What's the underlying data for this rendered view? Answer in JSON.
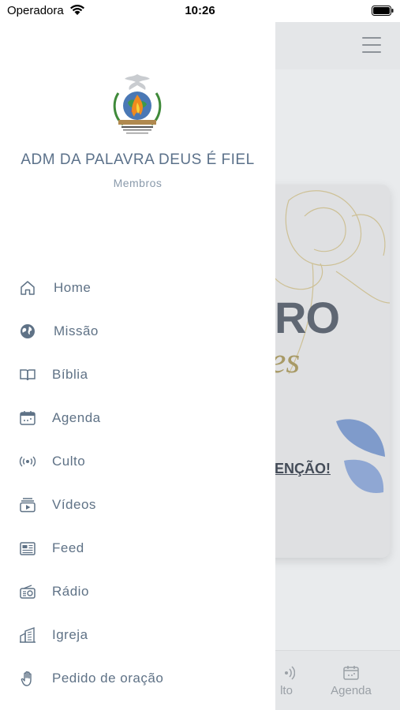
{
  "status_bar": {
    "carrier": "Operadora",
    "time": "10:26"
  },
  "drawer": {
    "church_name": "ADM DA PALAVRA DEUS É FIEL",
    "role": "Membros",
    "items": [
      {
        "label": "Home",
        "icon": "home-icon"
      },
      {
        "label": "Missão",
        "icon": "globe-icon"
      },
      {
        "label": "Bíblia",
        "icon": "book-icon"
      },
      {
        "label": "Agenda",
        "icon": "calendar-icon"
      },
      {
        "label": "Culto",
        "icon": "broadcast-icon"
      },
      {
        "label": "Vídeos",
        "icon": "video-icon"
      },
      {
        "label": "Feed",
        "icon": "newspaper-icon"
      },
      {
        "label": "Rádio",
        "icon": "radio-icon"
      },
      {
        "label": "Igreja",
        "icon": "building-icon"
      },
      {
        "label": "Pedido de oração",
        "icon": "hand-icon"
      }
    ]
  },
  "background": {
    "card_big_text": "RO",
    "card_script_text": "es",
    "card_cta_text": "ENÇÃO!",
    "tabs": [
      {
        "label": "lto"
      },
      {
        "label": "Agenda"
      }
    ]
  },
  "colors": {
    "drawer_text": "#5f7286",
    "scrim": "#e9ebed",
    "accent_gold": "#a89a66"
  }
}
